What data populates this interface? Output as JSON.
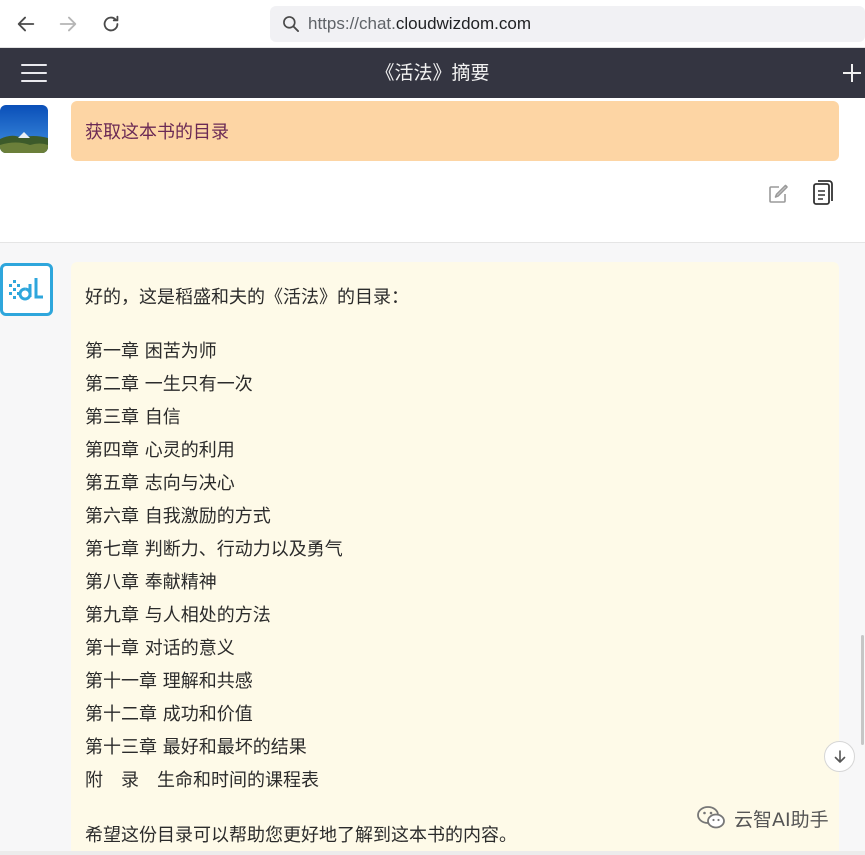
{
  "browser": {
    "url_prefix": "https://chat.",
    "url_host": "cloudwizdom.com",
    "icons": {
      "back": "arrow-left-icon",
      "forward": "arrow-right-icon",
      "reload": "reload-icon",
      "search": "search-icon"
    }
  },
  "header": {
    "title": "《活法》摘要",
    "icons": {
      "menu": "hamburger-menu-icon",
      "new": "plus-icon"
    }
  },
  "conversation": {
    "user_message": "获取这本书的目录",
    "user_actions": {
      "edit": "edit-icon",
      "copy": "copy-icon"
    },
    "assistant": {
      "intro": "好的，这是稻盛和夫的《活法》的目录：",
      "chapters": [
        "第一章 困苦为师",
        "第二章 一生只有一次",
        "第三章 自信",
        "第四章 心灵的利用",
        "第五章 志向与决心",
        "第六章 自我激励的方式",
        "第七章 判断力、行动力以及勇气",
        "第八章 奉献精神",
        "第九章 与人相处的方法",
        "第十章 对话的意义",
        "第十一章 理解和共感",
        "第十二章 成功和价值",
        "第十三章 最好和最坏的结果",
        "附　录　生命和时间的课程表"
      ],
      "outro": "希望这份目录可以帮助您更好地了解到这本书的内容。"
    }
  },
  "watermark": {
    "text": "云智AI助手"
  },
  "colors": {
    "header_bg": "#343541",
    "user_bubble": "#fdd5a4",
    "user_text": "#6b2a55",
    "assistant_bubble": "#fefae8",
    "ai_logo": "#2ea6dc"
  }
}
